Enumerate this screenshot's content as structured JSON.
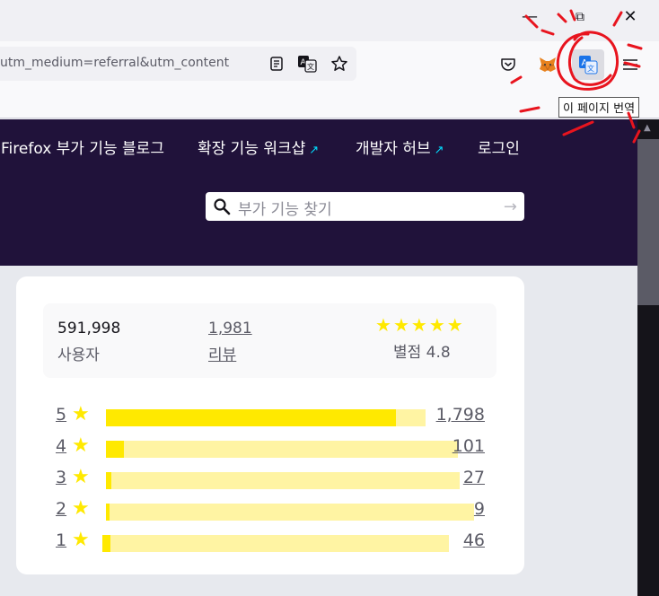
{
  "window": {
    "minimize_glyph": "—",
    "restore_glyph": "⧉",
    "close_glyph": "✕"
  },
  "toolbar": {
    "url_text": "utm_medium=referral&utm_content",
    "reader_icon": "reader-view-icon",
    "translate_icon": "translate-icon",
    "bookmark_icon": "star-icon",
    "pocket_icon": "pocket-icon",
    "metamask_icon": "fox-extension-icon",
    "active_translate_icon": "translate-extension-icon",
    "menu_icon": "hamburger-menu-icon",
    "tooltip": "이 페이지 번역"
  },
  "nav": {
    "items": [
      {
        "label": "Firefox 부가 기능 블로그",
        "external": false
      },
      {
        "label": "확장 기능 워크샵",
        "external": true
      },
      {
        "label": "개발자 허브",
        "external": true
      },
      {
        "label": "로그인",
        "external": false
      }
    ]
  },
  "search": {
    "placeholder": "부가 기능 찾기"
  },
  "stats": {
    "users_value": "591,998",
    "users_label": "사용자",
    "reviews_value": "1,981",
    "reviews_label": "리뷰",
    "rating_label": "별점 4.8",
    "rating_stars": 5
  },
  "ratings": [
    {
      "stars": "5",
      "count": "1,798",
      "fraction": 0.908
    },
    {
      "stars": "4",
      "count": "101",
      "fraction": 0.051
    },
    {
      "stars": "3",
      "count": "27",
      "fraction": 0.014
    },
    {
      "stars": "2",
      "count": "9",
      "fraction": 0.005
    },
    {
      "stars": "1",
      "count": "46",
      "fraction": 0.023
    }
  ],
  "colors": {
    "header_bg": "#20123a",
    "star": "#ffe900",
    "bar_bg": "#fff4a3",
    "annotation": "#e8141e"
  }
}
